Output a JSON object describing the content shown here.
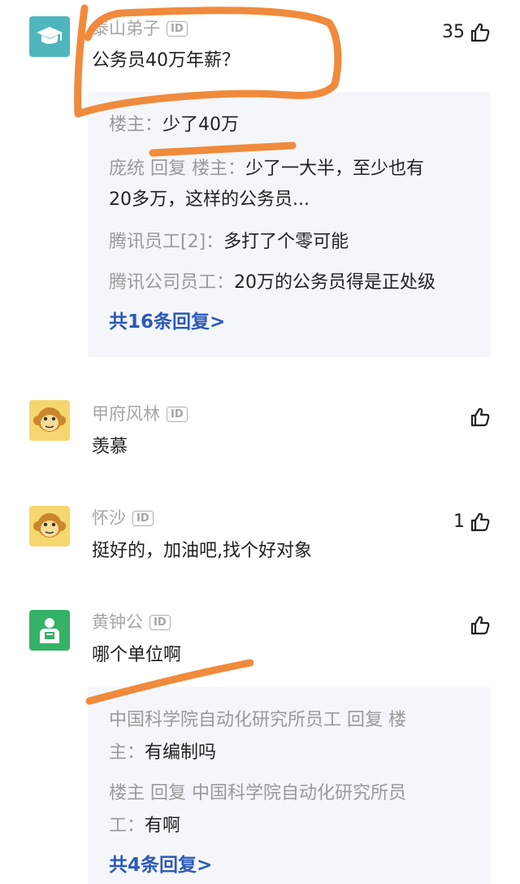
{
  "comments": [
    {
      "user": "泰山弟子",
      "id_badge": "ID",
      "text": "公务员40万年薪？",
      "likes": "35",
      "replies": [
        {
          "who": "楼主：",
          "text": "少了40万"
        },
        {
          "who": "庞统 回复 楼主：",
          "text": "少了一大半，至少也有",
          "text2": "20多万，这样的公务员..."
        },
        {
          "who": "腾讯员工[2]：",
          "text": "多打了个零可能"
        },
        {
          "who": "腾讯公司员工：",
          "text": "20万的公务员得是正处级"
        }
      ],
      "more": "共16条回复>"
    },
    {
      "user": "甲府风林",
      "id_badge": "ID",
      "text": "羡慕",
      "likes": ""
    },
    {
      "user": "怀沙",
      "id_badge": "ID",
      "text": "挺好的，加油吧,找个好对象",
      "likes": "1"
    },
    {
      "user": "黄钟公",
      "id_badge": "ID",
      "text": "哪个单位啊",
      "likes": "",
      "replies": [
        {
          "who": "中国科学院自动化研究所员工 回复 楼",
          "who2": "主：",
          "text": "有编制吗"
        },
        {
          "who": "楼主 回复 中国科学院自动化研究所员",
          "who2": "工：",
          "text": "有啊"
        }
      ],
      "more": "共4条回复>"
    }
  ],
  "colors": {
    "ink": "#f08a3c",
    "link": "#2d59b8",
    "avatar_teal": "#4fb6bd",
    "avatar_yellow": "#f6d66f",
    "avatar_green": "#36b168"
  },
  "icons": [
    "graduation-cap-icon",
    "monkey-icon",
    "person-icon",
    "thumbs-up-icon",
    "id-badge"
  ]
}
